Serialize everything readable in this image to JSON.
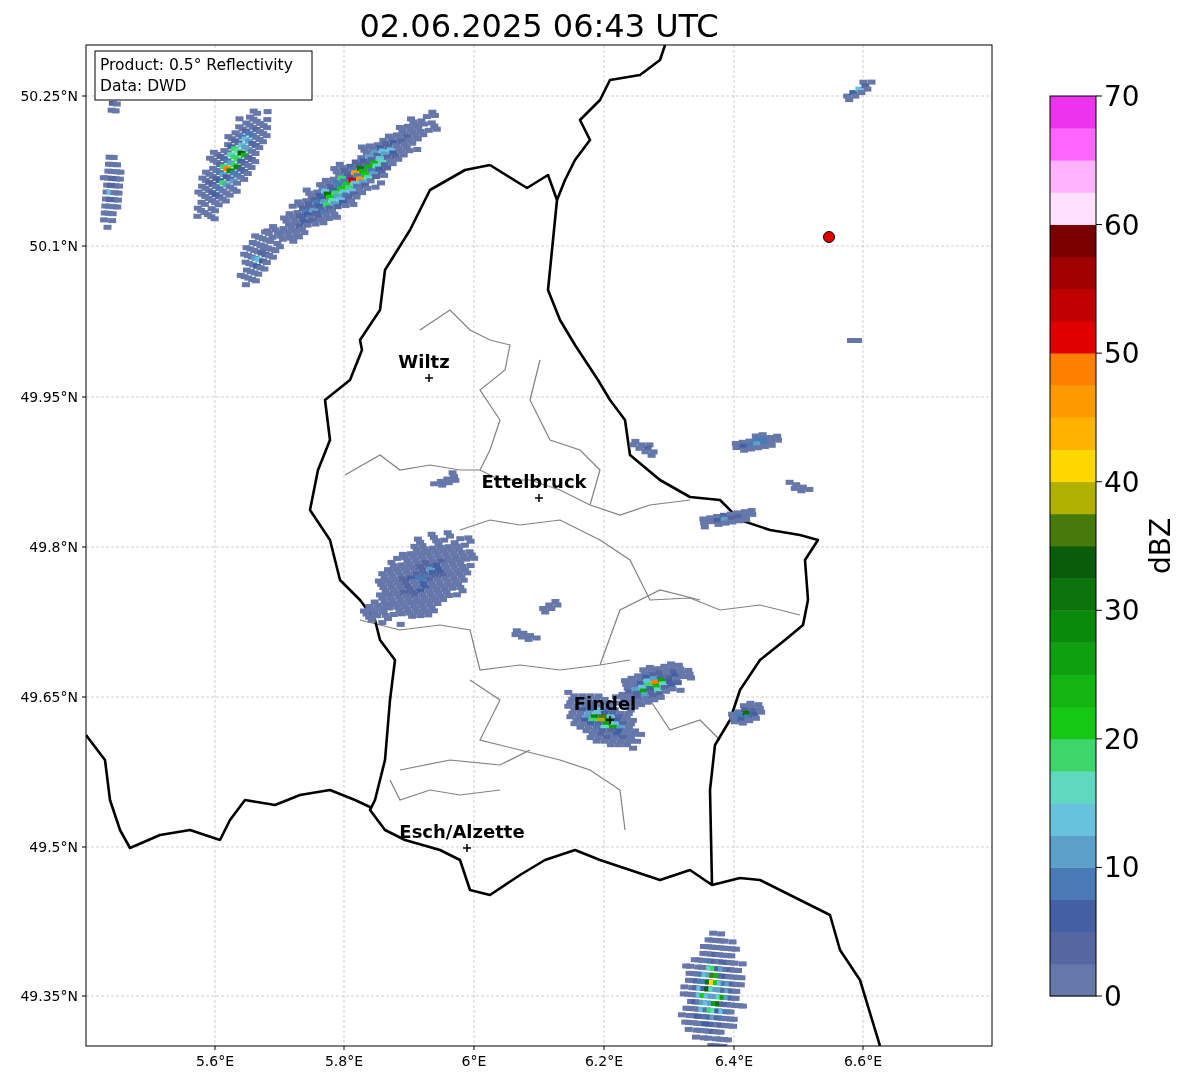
{
  "title": "02.06.2025 06:43 UTC",
  "annotation": [
    "Product: 0.5° Reflectivity",
    "Data: DWD"
  ],
  "latitude_labels": [
    "50.25°N",
    "50.1°N",
    "49.95°N",
    "49.8°N",
    "49.65°N",
    "49.5°N",
    "49.35°N"
  ],
  "longitude_labels": [
    "5.6°E",
    "5.8°E",
    "6°E",
    "6.2°E",
    "6.4°E",
    "6.6°E"
  ],
  "cities": [
    {
      "name": "Wiltz"
    },
    {
      "name": "Ettelbruck"
    },
    {
      "name": "Findel"
    },
    {
      "name": "Esch/Alzette"
    }
  ],
  "colorbar": {
    "label": "dBZ",
    "ticks": [
      "70",
      "60",
      "50",
      "40",
      "30",
      "20",
      "10",
      "0"
    ],
    "bins": [
      {
        "color": "#6677aa"
      },
      {
        "color": "#5566a0"
      },
      {
        "color": "#4460a5"
      },
      {
        "color": "#4a7ab5"
      },
      {
        "color": "#5aa0c8"
      },
      {
        "color": "#66c2dd"
      },
      {
        "color": "#5fd8c0"
      },
      {
        "color": "#3cd66a"
      },
      {
        "color": "#14c814"
      },
      {
        "color": "#12b512"
      },
      {
        "color": "#0fa00f"
      },
      {
        "color": "#0a8a0a"
      },
      {
        "color": "#0a740a"
      },
      {
        "color": "#0a5c0a"
      },
      {
        "color": "#467a0a"
      },
      {
        "color": "#b0b000"
      },
      {
        "color": "#ffd700"
      },
      {
        "color": "#ffb300"
      },
      {
        "color": "#ff9900"
      },
      {
        "color": "#ff7f00"
      },
      {
        "color": "#e00000"
      },
      {
        "color": "#c00000"
      },
      {
        "color": "#a00000"
      },
      {
        "color": "#7a0000"
      },
      {
        "color": "#ffe0ff"
      },
      {
        "color": "#ffb3ff"
      },
      {
        "color": "#ff66ff"
      },
      {
        "color": "#ee33ee"
      }
    ]
  }
}
